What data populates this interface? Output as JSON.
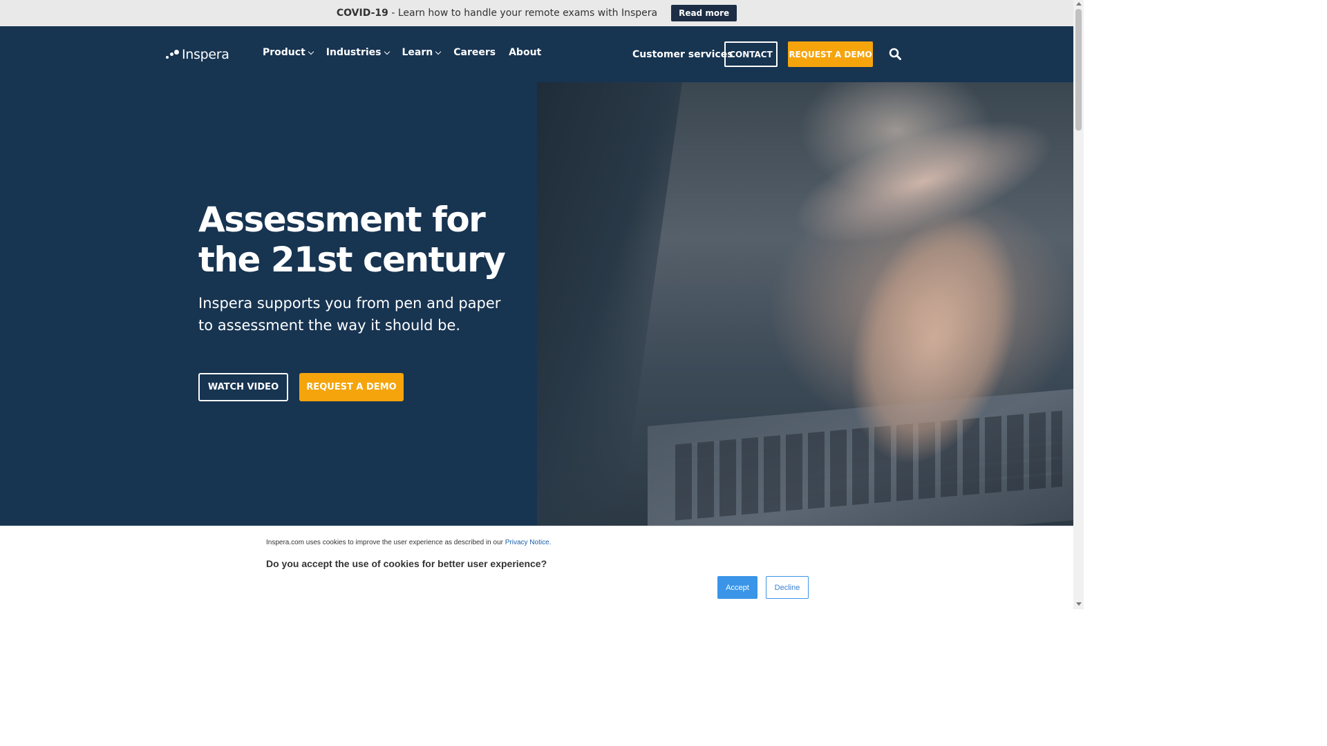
{
  "announcement": {
    "bold": "COVID-19",
    "text": " - Learn how to handle your remote exams with Inspera",
    "button": "Read more"
  },
  "header": {
    "brand": "Inspera",
    "nav": [
      {
        "label": "Product",
        "has_dropdown": true
      },
      {
        "label": "Industries",
        "has_dropdown": true
      },
      {
        "label": "Learn",
        "has_dropdown": true
      },
      {
        "label": "Careers",
        "has_dropdown": false
      },
      {
        "label": "About",
        "has_dropdown": false
      }
    ],
    "customer_services": "Customer services",
    "contact": "CONTACT",
    "request_demo": "REQUEST A DEMO"
  },
  "hero": {
    "headline": "Assessment for the 21st century",
    "subline": "Inspera supports you from pen and paper to assessment the way it should be.",
    "watch_video": "WATCH VIDEO",
    "request_demo": "REQUEST A DEMO"
  },
  "cookie": {
    "notice": "Inspera.com uses cookies to improve the user experience as described in our ",
    "privacy_link": "Privacy Notice.",
    "question": "Do you accept the use of cookies for better user experience?",
    "accept": "Accept",
    "decline": "Decline"
  },
  "colors": {
    "navy": "#173451",
    "accent": "#f5a40c",
    "cookie_blue": "#3a95e8"
  }
}
